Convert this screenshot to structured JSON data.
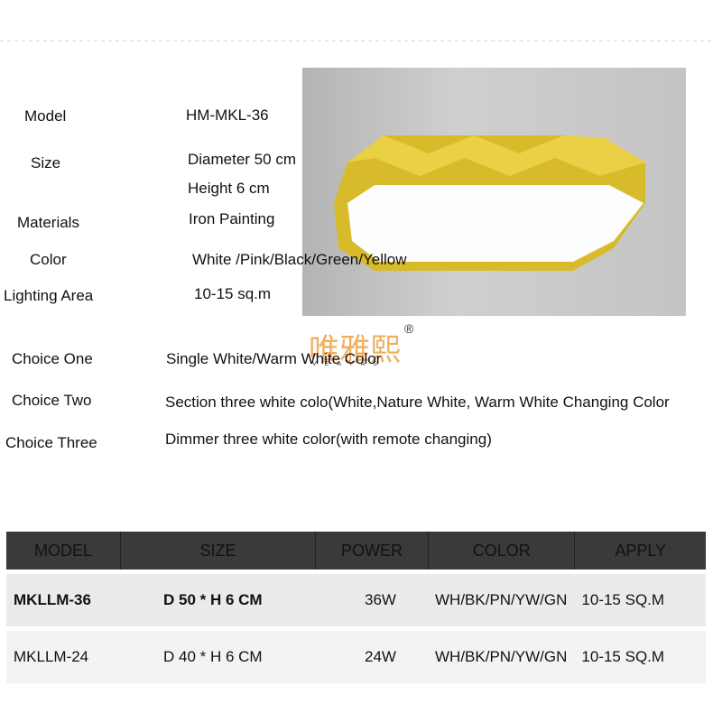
{
  "specs": [
    {
      "label": "Model",
      "value": "HM-MKL-36"
    },
    {
      "label": "Size",
      "value": "Diameter  50 cm",
      "value2": "Height 6 cm"
    },
    {
      "label": "Materials",
      "value": "Iron Painting"
    },
    {
      "label": "Color",
      "value": "White /Pink/Black/Green/Yellow"
    },
    {
      "label": "Lighting Area",
      "value": "10-15 sq.m"
    }
  ],
  "choices": [
    {
      "label": "Choice One",
      "value": "Single White/Warm White Color"
    },
    {
      "label": "Choice Two",
      "value": "Section three white colo(White,Nature White, Warm White Changing Color"
    },
    {
      "label": "Choice Three",
      "value": "Dimmer three white color(with remote changing)"
    }
  ],
  "logo": {
    "text": "唯雅熙",
    "registered": "®",
    "sub": "VEAYAS"
  },
  "table": {
    "headers": [
      "MODEL",
      "SIZE",
      "POWER",
      "COLOR",
      "APPLY"
    ],
    "rows": [
      [
        "MKLLM-36",
        "D 50 * H 6 CM",
        "36W",
        "WH/BK/PN/YW/GN",
        "10-15 SQ.M"
      ],
      [
        "MKLLM-24",
        "D 40 * H 6 CM",
        "24W",
        "WH/BK/PN/YW/GN",
        "10-15 SQ.M"
      ]
    ]
  },
  "colors": {
    "lamp": "#e0c431",
    "header": "#3a3a3a"
  }
}
